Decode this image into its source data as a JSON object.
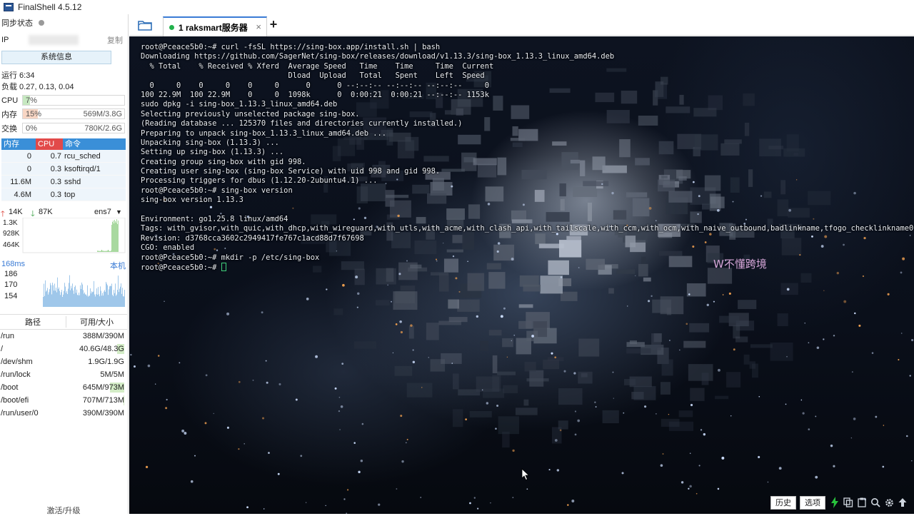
{
  "window": {
    "title": "FinalShell 4.5.12"
  },
  "sidebar": {
    "sync_label": "同步状态",
    "ip_label": "IP",
    "copy_label": "复制",
    "sysinfo_button": "系统信息",
    "uptime": "运行 6:34",
    "load": "负载 0.27, 0.13, 0.04",
    "cpu": {
      "label": "CPU",
      "percent": "7%",
      "fill": 0.07
    },
    "mem": {
      "label": "内存",
      "percent": "15%",
      "amount": "569M/3.8G",
      "fill": 0.15
    },
    "swap": {
      "label": "交换",
      "percent": "0%",
      "amount": "780K/2.6G",
      "fill": 0.0
    },
    "process_table": {
      "headers": [
        "内存",
        "CPU",
        "命令"
      ],
      "rows": [
        {
          "mem": "0",
          "cpu": "0.7",
          "cmd": "rcu_sched"
        },
        {
          "mem": "0",
          "cpu": "0.3",
          "cmd": "ksoftirqd/1"
        },
        {
          "mem": "11.6M",
          "cpu": "0.3",
          "cmd": "sshd"
        },
        {
          "mem": "4.6M",
          "cpu": "0.3",
          "cmd": "top"
        }
      ]
    },
    "network": {
      "up": "14K",
      "down": "87K",
      "interface": "ens7",
      "scale": [
        "1.3K",
        "928K",
        "464K"
      ]
    },
    "ping": {
      "latency": "168ms",
      "target": "本机",
      "scale": [
        "186",
        "170",
        "154"
      ]
    },
    "disk_table": {
      "headers": [
        "路径",
        "可用/大小"
      ],
      "rows": [
        {
          "path": "/run",
          "size": "388M/390M",
          "usage": 0.005
        },
        {
          "path": "/",
          "size": "40.6G/48.3G",
          "usage": 0.16
        },
        {
          "path": "/dev/shm",
          "size": "1.9G/1.9G",
          "usage": 0.0
        },
        {
          "path": "/run/lock",
          "size": "5M/5M",
          "usage": 0.0
        },
        {
          "path": "/boot",
          "size": "645M/973M",
          "usage": 0.34
        },
        {
          "path": "/boot/efi",
          "size": "707M/713M",
          "usage": 0.01
        },
        {
          "path": "/run/user/0",
          "size": "390M/390M",
          "usage": 0.0
        }
      ]
    },
    "activate_label": "激活/升级"
  },
  "tabs": [
    {
      "label": "1 raksmart服务器",
      "close": "×"
    }
  ],
  "add_tab_label": "+",
  "terminal": {
    "lines": [
      "root@Pceace5b0:~# curl -fsSL https://sing-box.app/install.sh | bash",
      "Downloading https://github.com/SagerNet/sing-box/releases/download/v1.13.3/sing-box_1.13.3_linux_amd64.deb",
      "  % Total    % Received % Xferd  Average Speed   Time    Time     Time  Current",
      "                                 Dload  Upload   Total   Spent    Left  Speed",
      "  0     0    0     0    0     0      0      0 --:--:-- --:--:-- --:--:--     0",
      "100 22.9M  100 22.9M    0     0  1098k      0  0:00:21  0:00:21 --:--:-- 1153k",
      "sudo dpkg -i sing-box_1.13.3_linux_amd64.deb",
      "Selecting previously unselected package sing-box.",
      "(Reading database ... 125370 files and directories currently installed.)",
      "Preparing to unpack sing-box_1.13.3_linux_amd64.deb ...",
      "Unpacking sing-box (1.13.3) ...",
      "Setting up sing-box (1.13.3) ...",
      "Creating group sing-box with gid 998.",
      "Creating user sing-box (sing-box Service) with uid 998 and gid 998.",
      "Processing triggers for dbus (1.12.20-2ubuntu4.1) ...",
      "root@Pceace5b0:~# sing-box version",
      "sing-box version 1.13.3",
      "",
      "Environment: go1.25.8 linux/amd64",
      "Tags: with_gvisor,with_quic,with_dhcp,with_wireguard,with_utls,with_acme,with_clash_api,with_tailscale,with_ccm,with_ocm,with_naive_outbound,badlinkname,tfogo_checklinkname0",
      "Revision: d3768cca3602c2949417fe767c1acd88d7f67698",
      "CGO: enabled",
      "root@Pceace5b0:~# mkdir -p /etc/sing-box",
      "root@Pceace5b0:~# "
    ],
    "watermark": "W不懂跨境"
  },
  "toolbar": {
    "history_label": "历史",
    "options_label": "选项"
  },
  "colors": {
    "cpu_fill": "#c6e8c0",
    "mem_fill": "#f8d6c4",
    "proc_head_mem": "#3a8fd8",
    "proc_head_cpu": "#e24a4a",
    "proc_head_cmd": "#3a8fd8",
    "net_up": "#d9342b",
    "net_down": "#2e9b3a",
    "chart_fill": "#a9d9a0",
    "ping_fill": "#9fc7ea",
    "cursor": "#3fd07a"
  },
  "icons": [
    "app-icon",
    "sync-dot",
    "folder-icon",
    "tab-status-dot",
    "close-icon",
    "add-icon",
    "dropdown-icon",
    "lightning-icon",
    "copy-icon",
    "paste-icon",
    "search-icon",
    "gear-icon",
    "arrow-up-icon"
  ]
}
